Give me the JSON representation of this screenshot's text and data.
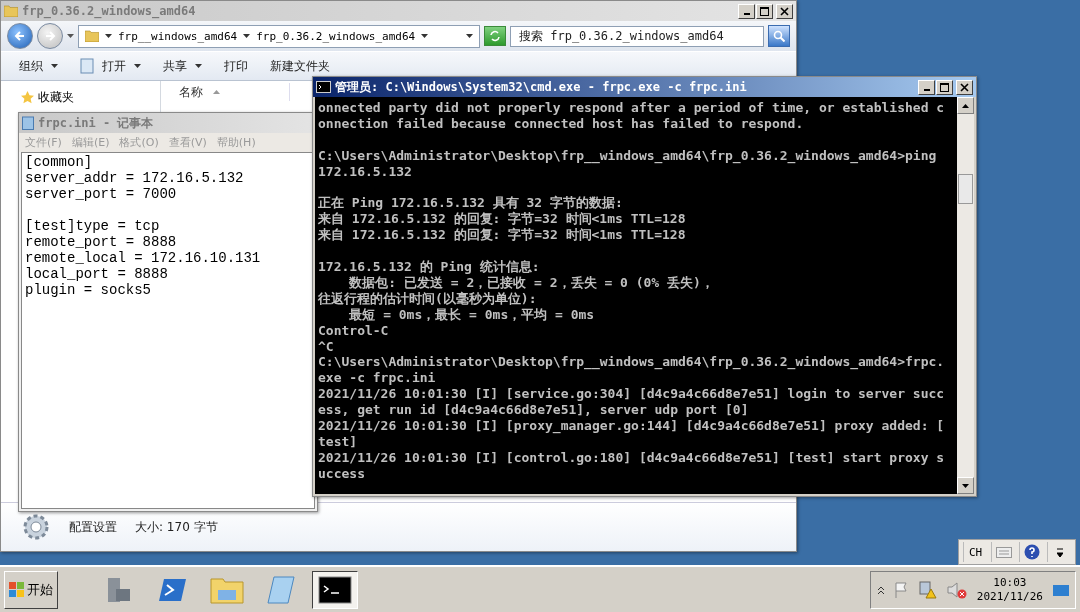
{
  "explorer": {
    "title": "frp_0.36.2_windows_amd64",
    "active": false,
    "breadcrumbs": [
      "frp__windows_amd64",
      "frp_0.36.2_windows_amd64"
    ],
    "search": {
      "placeholder": "搜索 frp_0.36.2_windows_amd64"
    },
    "toolbar": [
      {
        "label": "组织",
        "kind": "menu"
      },
      {
        "label": "打开",
        "kind": "open"
      },
      {
        "label": "共享",
        "kind": "menu"
      },
      {
        "label": "打印",
        "kind": "plain"
      },
      {
        "label": "新建文件夹",
        "kind": "plain"
      }
    ],
    "favorites": "收藏夹",
    "column_header": "名称",
    "details": {
      "file_type": "配置设置",
      "size": "大小: 170 字节"
    }
  },
  "notepad": {
    "title": "frpc.ini - 记事本",
    "active": false,
    "menus": [
      "文件(F)",
      "编辑(E)",
      "格式(O)",
      "查看(V)",
      "帮助(H)"
    ],
    "blocks": [
      [
        "[common]",
        "server_addr = 172.16.5.132",
        "server_port = 7000"
      ],
      [
        "[test]type = tcp",
        "remote_port = 8888",
        "remote_local = 172.16.10.131",
        "local_port = 8888",
        "plugin = socks5"
      ]
    ]
  },
  "cmd": {
    "title": "管理员: C:\\Windows\\System32\\cmd.exe - frpc.exe  -c frpc.ini",
    "active": true,
    "blocks": [
      [
        "onnected party did not properly respond after a period of time, or established c",
        "onnection failed because connected host has failed to respond."
      ],
      [
        "C:\\Users\\Administrator\\Desktop\\frp__windows_amd64\\frp_0.36.2_windows_amd64>ping",
        "172.16.5.132"
      ],
      [
        "正在 Ping 172.16.5.132 具有 32 字节的数据:",
        "来自 172.16.5.132 的回复: 字节=32 时间<1ms TTL=128",
        "来自 172.16.5.132 的回复: 字节=32 时间<1ms TTL=128"
      ],
      [
        "172.16.5.132 的 Ping 统计信息:",
        "    数据包: 已发送 = 2，已接收 = 2，丢失 = 0 (0% 丢失)，",
        "往返行程的估计时间(以毫秒为单位):",
        "    最短 = 0ms，最长 = 0ms，平均 = 0ms",
        "Control-C",
        "^C",
        "C:\\Users\\Administrator\\Desktop\\frp__windows_amd64\\frp_0.36.2_windows_amd64>frpc.",
        "exe -c frpc.ini",
        "2021/11/26 10:01:30 [I] [service.go:304] [d4c9a4c66d8e7e51] login to server succ",
        "ess, get run id [d4c9a4c66d8e7e51], server udp port [0]",
        "2021/11/26 10:01:30 [I] [proxy_manager.go:144] [d4c9a4c66d8e7e51] proxy added: [",
        "test]",
        "2021/11/26 10:01:30 [I] [control.go:180] [d4c9a4c66d8e7e51] [test] start proxy s",
        "uccess"
      ]
    ]
  },
  "language_bar": {
    "language": "CH"
  },
  "taskbar": {
    "start": "开始",
    "apps": [
      {
        "kind": "server-manager",
        "selected": false
      },
      {
        "kind": "powershell",
        "selected": false
      },
      {
        "kind": "explorer",
        "selected": false
      },
      {
        "kind": "notepad",
        "selected": false
      },
      {
        "kind": "cmd",
        "selected": true
      }
    ],
    "clock": {
      "time": "10:03",
      "date": "2021/11/26"
    }
  }
}
